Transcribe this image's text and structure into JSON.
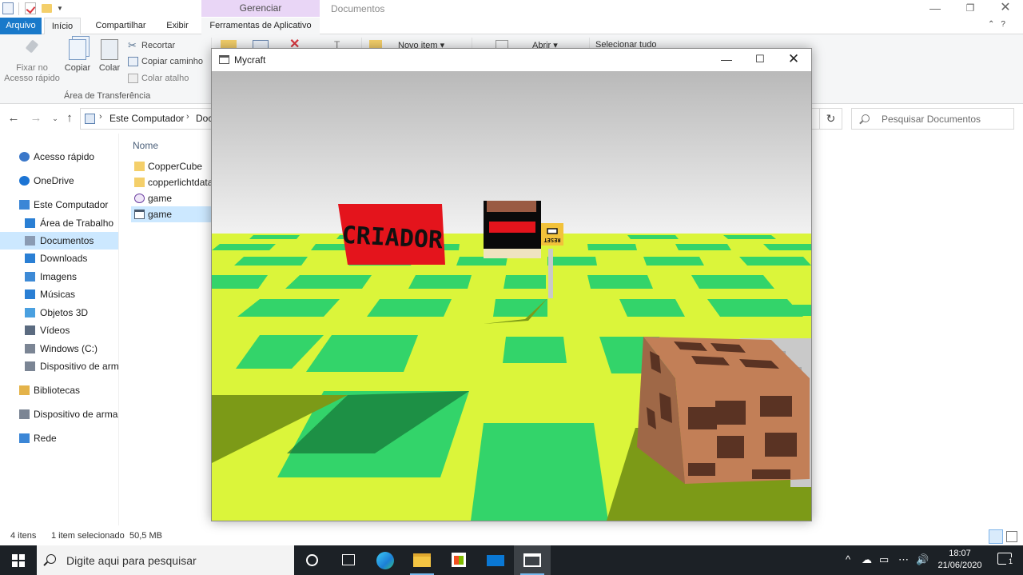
{
  "explorer": {
    "title": "Documentos",
    "context_tab_header": "Gerenciar",
    "controls": {
      "minimize": "—",
      "restore": "❐",
      "close": "✕"
    }
  },
  "ribbon": {
    "tabs": [
      "Arquivo",
      "Início",
      "Compartilhar",
      "Exibir",
      "Ferramentas de Aplicativo"
    ],
    "right_icons": "⌃?",
    "clipboard": {
      "pin": "Fixar no Acesso rápido",
      "copy": "Copiar",
      "paste": "Colar",
      "cut": "Recortar",
      "copy_path": "Copiar caminho",
      "paste_shortcut": "Colar atalho",
      "group_label": "Área de Transferência"
    },
    "new_item": "Novo item ▾",
    "open": "Abrir ▾",
    "select_all": "Selecionar tudo"
  },
  "address": {
    "back": "←",
    "forward": "→",
    "recent": "⌄",
    "up": "↑",
    "sep": "›",
    "crumbs": [
      "Este Computador",
      "Doc"
    ],
    "refresh": "↻",
    "search_placeholder": "Pesquisar Documentos"
  },
  "nav_pane": {
    "items": [
      {
        "label": "Acesso rápido",
        "icon": "star-icon",
        "level": 1,
        "selected": false
      },
      {
        "label": "OneDrive",
        "icon": "cloud-icon",
        "level": 1,
        "selected": false
      },
      {
        "label": "Este Computador",
        "icon": "computer-icon",
        "level": 1,
        "selected": false
      },
      {
        "label": "Área de Trabalho",
        "icon": "desktop-icon",
        "level": 2,
        "selected": false
      },
      {
        "label": "Documentos",
        "icon": "documents-icon",
        "level": 2,
        "selected": true
      },
      {
        "label": "Downloads",
        "icon": "download-icon",
        "level": 2,
        "selected": false
      },
      {
        "label": "Imagens",
        "icon": "pictures-icon",
        "level": 2,
        "selected": false
      },
      {
        "label": "Músicas",
        "icon": "music-icon",
        "level": 2,
        "selected": false
      },
      {
        "label": "Objetos 3D",
        "icon": "cube-icon",
        "level": 2,
        "selected": false
      },
      {
        "label": "Vídeos",
        "icon": "video-icon",
        "level": 2,
        "selected": false
      },
      {
        "label": "Windows (C:)",
        "icon": "drive-icon",
        "level": 2,
        "selected": false
      },
      {
        "label": "Dispositivo de arma",
        "icon": "drive-icon",
        "level": 2,
        "selected": false
      },
      {
        "label": "Bibliotecas",
        "icon": "libraries-icon",
        "level": 1,
        "selected": false
      },
      {
        "label": "Dispositivo de armaze",
        "icon": "usb-drive-icon",
        "level": 1,
        "selected": false
      },
      {
        "label": "Rede",
        "icon": "network-icon",
        "level": 1,
        "selected": false
      }
    ]
  },
  "file_list": {
    "column_name": "Nome",
    "files": [
      {
        "name": "CopperCube",
        "icon": "folder-icon",
        "selected": false
      },
      {
        "name": "copperlichtdata",
        "icon": "folder-icon",
        "selected": false
      },
      {
        "name": "game",
        "icon": "coppercube-file-icon",
        "selected": false
      },
      {
        "name": "game",
        "icon": "application-icon",
        "selected": true
      }
    ]
  },
  "status": {
    "count": "4 itens",
    "selected": "1 item selecionado",
    "size": "50,5 MB"
  },
  "game_window": {
    "title": "Mycraft",
    "controls": {
      "minimize": "—",
      "maximize": "☐",
      "close": "✕"
    },
    "scene": {
      "sign_text": "CRIADOR",
      "small_sign_text": "RESET",
      "colors": {
        "sky_top": "#b9b9b9",
        "sky_bottom": "#f2f2f2",
        "ground": "#dbf53a",
        "tile": "#33d46a",
        "shadow": "#7c9a17",
        "sign_red": "#e4141c",
        "block_brown": "#c27f57",
        "block_spots": "#5a3323",
        "stone": "#c9c9c9"
      }
    }
  },
  "taskbar": {
    "search_placeholder": "Digite aqui para pesquisar",
    "time": "18:07",
    "date": "21/06/2020",
    "notification_count": "1",
    "tray_icons": [
      "^",
      "☁",
      "▭",
      "⋯",
      "🔊"
    ]
  }
}
